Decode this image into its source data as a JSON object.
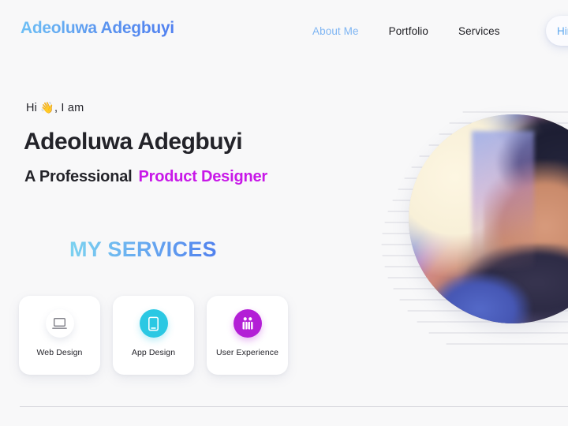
{
  "page": {
    "background_color": "#f8f8f9"
  },
  "header": {
    "logo": "Adeoluwa Adegbuyi",
    "logo_gradient_from": "#6ec0f5",
    "logo_gradient_to": "#4f7ff0",
    "nav": [
      {
        "label": "About Me",
        "active": true,
        "color": "#7eb5f3"
      },
      {
        "label": "Portfolio",
        "active": false,
        "color": "#1d1d22"
      },
      {
        "label": "Services",
        "active": false,
        "color": "#1d1d22"
      }
    ],
    "cta": {
      "label": "Hire Me",
      "text_color": "#5fa8ee",
      "background_color": "#fbfbfe"
    }
  },
  "hero": {
    "greeting_prefix": "Hi ",
    "greeting_wave": "👋",
    "greeting_suffix": ",  I am",
    "name": "Adeoluwa Adegbuyi",
    "role_prefix": "A Professional",
    "role_accent": "Product Designer",
    "role_accent_color": "#c818e8"
  },
  "services": {
    "title": "MY SERVICES",
    "title_gradient_from": "#7cd3f0",
    "title_gradient_to": "#5080ee",
    "cards": [
      {
        "label": "Web Design",
        "icon": "laptop-icon",
        "icon_style": "plain",
        "circle_color": "#ffffff",
        "glyph_color": "#6f6f78"
      },
      {
        "label": "App Design",
        "icon": "mobile-phone-icon",
        "icon_style": "cyan",
        "circle_color": "#2bc8e3",
        "glyph_color": "#ffffff"
      },
      {
        "label": "User Experience",
        "icon": "users-icon",
        "icon_style": "purple",
        "circle_color": "#b31fd6",
        "glyph_color": "#ffffff"
      }
    ]
  },
  "portrait": {
    "alt": "profile-photo",
    "shape": "circle",
    "backdrop_color": "#f7f0dc",
    "decor": "horizontal-speed-lines",
    "decor_line_color": "#d9d9e0"
  },
  "footer": {
    "divider_color": "#d6d6dc"
  }
}
